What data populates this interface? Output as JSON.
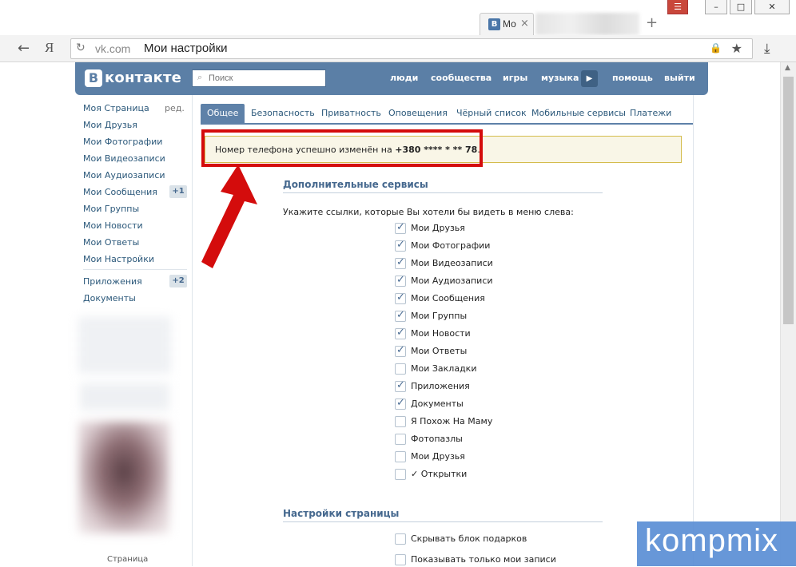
{
  "browser": {
    "tab_title": "Мо",
    "tab_favicon": "В",
    "new_tab": "+",
    "omnibox_domain": "vk.com",
    "page_title": "Мои настройки",
    "yandex_glyph": "Я"
  },
  "vk": {
    "logo_letter": "В",
    "logo_word": "контакте",
    "search_placeholder": "Поиск",
    "nav": [
      "люди",
      "сообщества",
      "игры",
      "музыка",
      "помощь",
      "выйти"
    ],
    "left_menu": [
      "Моя Страница",
      "Мои Друзья",
      "Мои Фотографии",
      "Мои Видеозаписи",
      "Мои Аудиозаписи",
      "Мои Сообщения",
      "Мои Группы",
      "Мои Новости",
      "Мои Ответы",
      "Мои Настройки"
    ],
    "edit_link": "ред.",
    "messages_badge": "+1",
    "apps": "Приложения",
    "apps_badge": "+2",
    "docs": "Документы",
    "blurred_caption": "Страница"
  },
  "tabs": [
    "Общее",
    "Безопасность",
    "Приватность",
    "Оповещения",
    "Чёрный список",
    "Мобильные сервисы",
    "Платежи"
  ],
  "notice": {
    "prefix": "Номер телефона успешно изменён на ",
    "phone": "+380 **** * ** 78",
    "suffix": "."
  },
  "services": {
    "title": "Дополнительные сервисы",
    "hint": "Укажите ссылки, которые Вы хотели бы видеть в меню слева:",
    "items": [
      {
        "label": "Мои Друзья",
        "checked": true
      },
      {
        "label": "Мои Фотографии",
        "checked": true
      },
      {
        "label": "Мои Видеозаписи",
        "checked": true
      },
      {
        "label": "Мои Аудиозаписи",
        "checked": true
      },
      {
        "label": "Мои Сообщения",
        "checked": true
      },
      {
        "label": "Мои Группы",
        "checked": true
      },
      {
        "label": "Мои Новости",
        "checked": true
      },
      {
        "label": "Мои Ответы",
        "checked": true
      },
      {
        "label": "Мои Закладки",
        "checked": false
      },
      {
        "label": "Приложения",
        "checked": true
      },
      {
        "label": "Документы",
        "checked": true
      },
      {
        "label": "Я Похож На Маму",
        "checked": false
      },
      {
        "label": "Фотопазлы",
        "checked": false
      },
      {
        "label": "Мои Друзья",
        "checked": false
      },
      {
        "label": "✓ Открытки",
        "checked": false
      }
    ]
  },
  "page_settings": {
    "title": "Настройки страницы",
    "items": [
      {
        "label": "Скрывать блок подарков",
        "checked": false
      },
      {
        "label": "Показывать только мои записи",
        "checked": false
      }
    ]
  },
  "watermark": "kompmix",
  "colors": {
    "vk_blue": "#5b7fa6",
    "highlight_red": "#d40c0c",
    "notice_bg": "#f9f6e7"
  }
}
